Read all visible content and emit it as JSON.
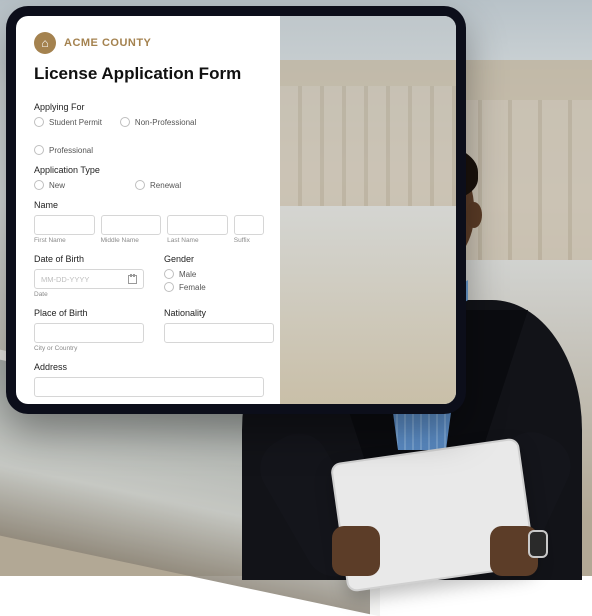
{
  "brand": {
    "name": "ACME COUNTY",
    "logo_glyph": "⌂"
  },
  "form": {
    "title": "License Application Form",
    "applying_for": {
      "label": "Applying For",
      "options": [
        "Student Permit",
        "Non-Professional",
        "Professional"
      ]
    },
    "application_type": {
      "label": "Application Type",
      "options": [
        "New",
        "Renewal"
      ]
    },
    "name": {
      "label": "Name",
      "sublabels": {
        "first": "First Name",
        "middle": "Middle Name",
        "last": "Last Name",
        "suffix": "Suffix"
      }
    },
    "dob": {
      "label": "Date of Birth",
      "placeholder": "MM-DD-YYYY",
      "sublabel": "Date"
    },
    "gender": {
      "label": "Gender",
      "options": [
        "Male",
        "Female"
      ]
    },
    "place_of_birth": {
      "label": "Place of Birth",
      "sublabel": "City or Country"
    },
    "nationality": {
      "label": "Nationality"
    },
    "address": {
      "label": "Address"
    }
  }
}
